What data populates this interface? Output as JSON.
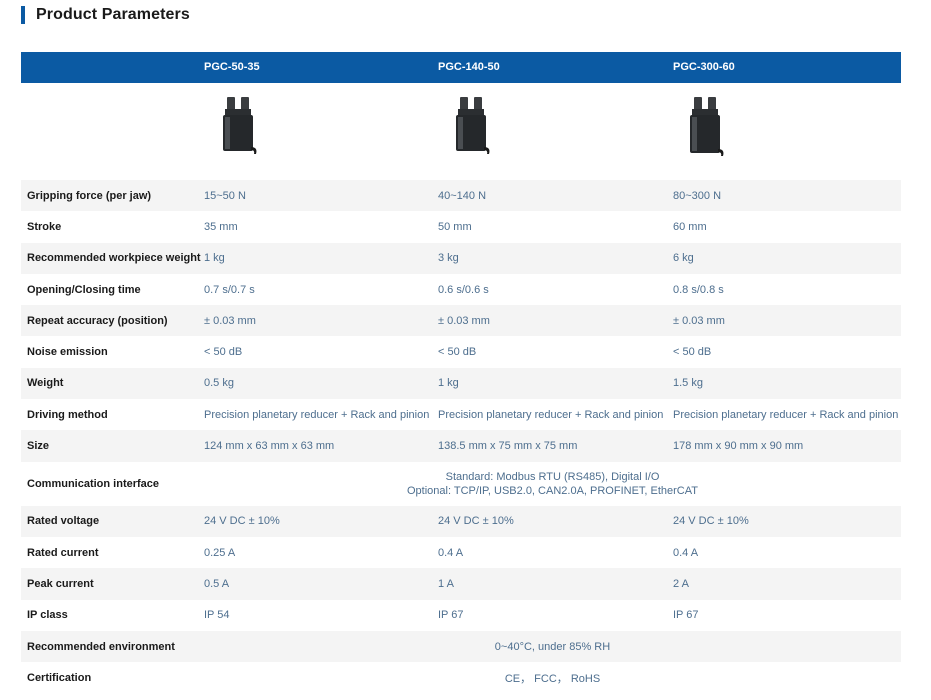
{
  "section": {
    "title": "Product Parameters"
  },
  "colors": {
    "accent": "#0b5aa3",
    "label_text": "#1a1a1a",
    "value_text": "#4d6e8e",
    "row_shade": "#f4f4f4"
  },
  "models": [
    "PGC-50-35",
    "PGC-140-50",
    "PGC-300-60"
  ],
  "rows": [
    {
      "label": "Gripping force (per jaw)",
      "values": [
        "15~50 N",
        "40~140 N",
        "80~300 N"
      ]
    },
    {
      "label": "Stroke",
      "values": [
        "35 mm",
        "50 mm",
        "60 mm"
      ]
    },
    {
      "label": "Recommended workpiece weight",
      "values": [
        "1 kg",
        "3 kg",
        "6 kg"
      ]
    },
    {
      "label": "Opening/Closing time",
      "values": [
        "0.7 s/0.7 s",
        "0.6 s/0.6 s",
        "0.8 s/0.8 s"
      ]
    },
    {
      "label": "Repeat accuracy (position)",
      "values": [
        "± 0.03 mm",
        "± 0.03 mm",
        "± 0.03 mm"
      ]
    },
    {
      "label": "Noise emission",
      "values": [
        "< 50 dB",
        "< 50 dB",
        "< 50 dB"
      ]
    },
    {
      "label": "Weight",
      "values": [
        "0.5 kg",
        "1 kg",
        "1.5 kg"
      ]
    },
    {
      "label": "Driving method",
      "values": [
        "Precision planetary reducer + Rack and pinion",
        "Precision planetary reducer + Rack and pinion",
        "Precision planetary reducer + Rack and pinion"
      ]
    },
    {
      "label": "Size",
      "values": [
        "124 mm x 63 mm x 63 mm",
        "138.5 mm x 75 mm x 75 mm",
        "178 mm x 90 mm x 90 mm"
      ]
    },
    {
      "label": "Communication interface",
      "span_lines": [
        "Standard: Modbus RTU (RS485), Digital I/O",
        "Optional: TCP/IP, USB2.0, CAN2.0A, PROFINET, EtherCAT"
      ]
    },
    {
      "label": "Rated voltage",
      "values": [
        "24 V DC ± 10%",
        "24 V DC ± 10%",
        "24 V DC ± 10%"
      ]
    },
    {
      "label": "Rated current",
      "values": [
        "0.25 A",
        "0.4 A",
        "0.4 A"
      ]
    },
    {
      "label": "Peak current",
      "values": [
        "0.5 A",
        "1 A",
        "2 A"
      ]
    },
    {
      "label": "IP class",
      "values": [
        "IP 54",
        "IP 67",
        "IP 67"
      ]
    },
    {
      "label": "Recommended environment",
      "span": "0~40°C, under 85% RH"
    },
    {
      "label": "Certification",
      "span": "CE，  FCC，  RoHS"
    }
  ]
}
